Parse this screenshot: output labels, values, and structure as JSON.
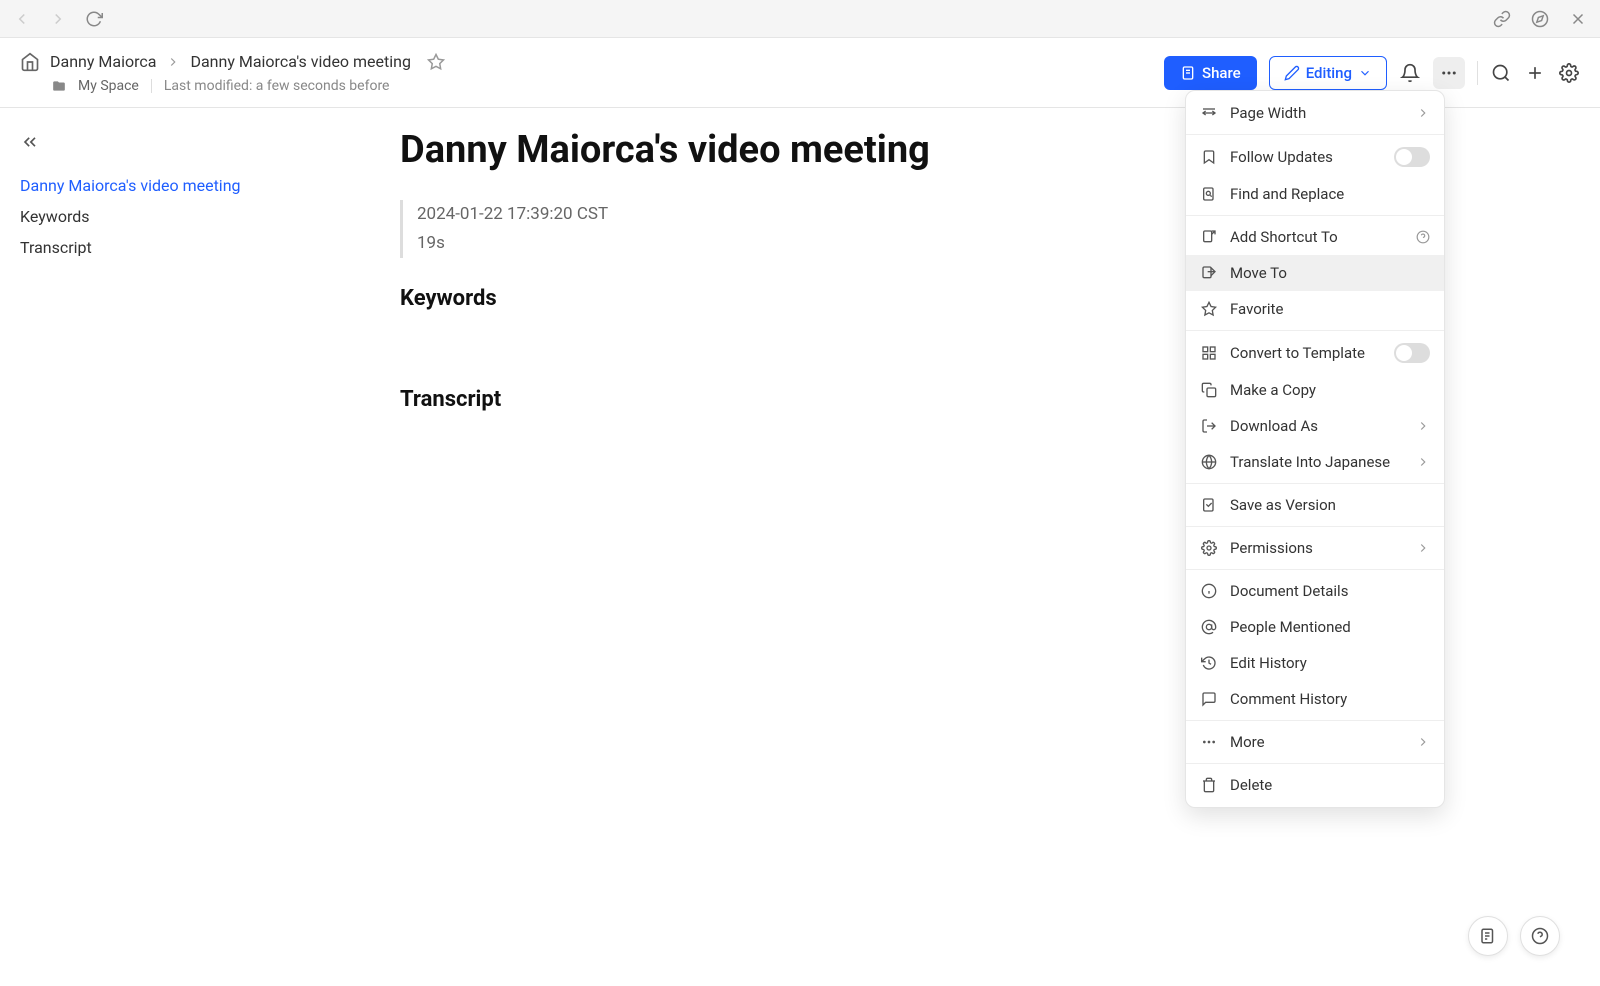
{
  "breadcrumb": {
    "parent": "Danny Maiorca",
    "current": "Danny Maiorca's video meeting",
    "space": "My Space",
    "modified": "Last modified: a few seconds before"
  },
  "header": {
    "share_label": "Share",
    "editing_label": "Editing"
  },
  "toc": {
    "items": [
      {
        "label": "Danny Maiorca's video meeting",
        "active": true
      },
      {
        "label": "Keywords",
        "active": false
      },
      {
        "label": "Transcript",
        "active": false
      }
    ]
  },
  "document": {
    "title": "Danny Maiorca's video meeting",
    "timestamp": "2024-01-22 17:39:20 CST",
    "duration": "19s",
    "section_keywords": "Keywords",
    "section_transcript": "Transcript"
  },
  "menu": {
    "page_width": "Page Width",
    "follow_updates": "Follow Updates",
    "find_replace": "Find and Replace",
    "add_shortcut": "Add Shortcut To",
    "move_to": "Move To",
    "favorite": "Favorite",
    "convert_template": "Convert to Template",
    "make_copy": "Make a Copy",
    "download_as": "Download As",
    "translate": "Translate Into Japanese",
    "save_version": "Save as Version",
    "permissions": "Permissions",
    "doc_details": "Document Details",
    "people_mentioned": "People Mentioned",
    "edit_history": "Edit History",
    "comment_history": "Comment History",
    "more": "More",
    "delete": "Delete"
  }
}
